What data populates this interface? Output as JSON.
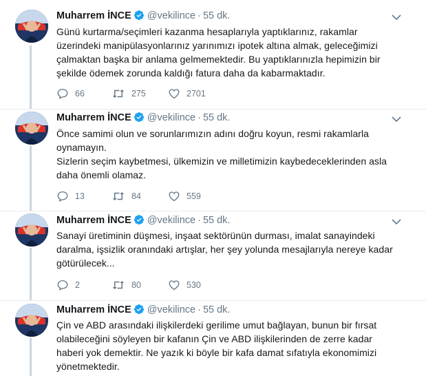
{
  "tweets": [
    {
      "name": "Muharrem İNCE",
      "handle": "@vekilince",
      "time": "55 dk.",
      "paragraphs": [
        "Günü kurtarma/seçimleri kazanma hesaplarıyla yaptıklarınız, rakamlar üzerindeki manipülasyonlarınız yarınımızı ipotek altına almak, geleceğimizi çalmaktan başka bir anlama gelmemektedir. Bu yaptıklarınızla hepimizin bir şekilde ödemek zorunda kaldığı fatura daha da kabarmaktadır."
      ],
      "replies": "66",
      "retweets": "275",
      "likes": "2701"
    },
    {
      "name": "Muharrem İNCE",
      "handle": "@vekilince",
      "time": "55 dk.",
      "paragraphs": [
        "Önce samimi olun ve sorunlarımızın adını doğru koyun, resmi rakamlarla oynamayın.",
        "Sizlerin seçim kaybetmesi, ülkemizin ve milletimizin kaybedeceklerinden asla daha önemli olamaz."
      ],
      "replies": "13",
      "retweets": "84",
      "likes": "559"
    },
    {
      "name": "Muharrem İNCE",
      "handle": "@vekilince",
      "time": "55 dk.",
      "paragraphs": [
        "Sanayi üretiminin düşmesi, inşaat sektörünün durması, imalat sanayindeki daralma, işsizlik oranındaki artışlar, her şey yolunda mesajlarıyla nereye kadar götürülecek..."
      ],
      "replies": "2",
      "retweets": "80",
      "likes": "530"
    },
    {
      "name": "Muharrem İNCE",
      "handle": "@vekilince",
      "time": "55 dk.",
      "paragraphs": [
        "Çin ve ABD arasındaki ilişkilerdeki gerilime umut bağlayan, bunun bir fırsat olabileceğini söyleyen bir kafanın Çin ve ABD ilişkilerinden de zerre kadar haberi yok demektir. Ne yazık ki böyle bir kafa damat sıfatıyla ekonomimizi yönetmektedir."
      ]
    }
  ],
  "colors": {
    "verified": "#1da1f2",
    "secondary": "#657786",
    "thread": "#ccd6dd"
  }
}
